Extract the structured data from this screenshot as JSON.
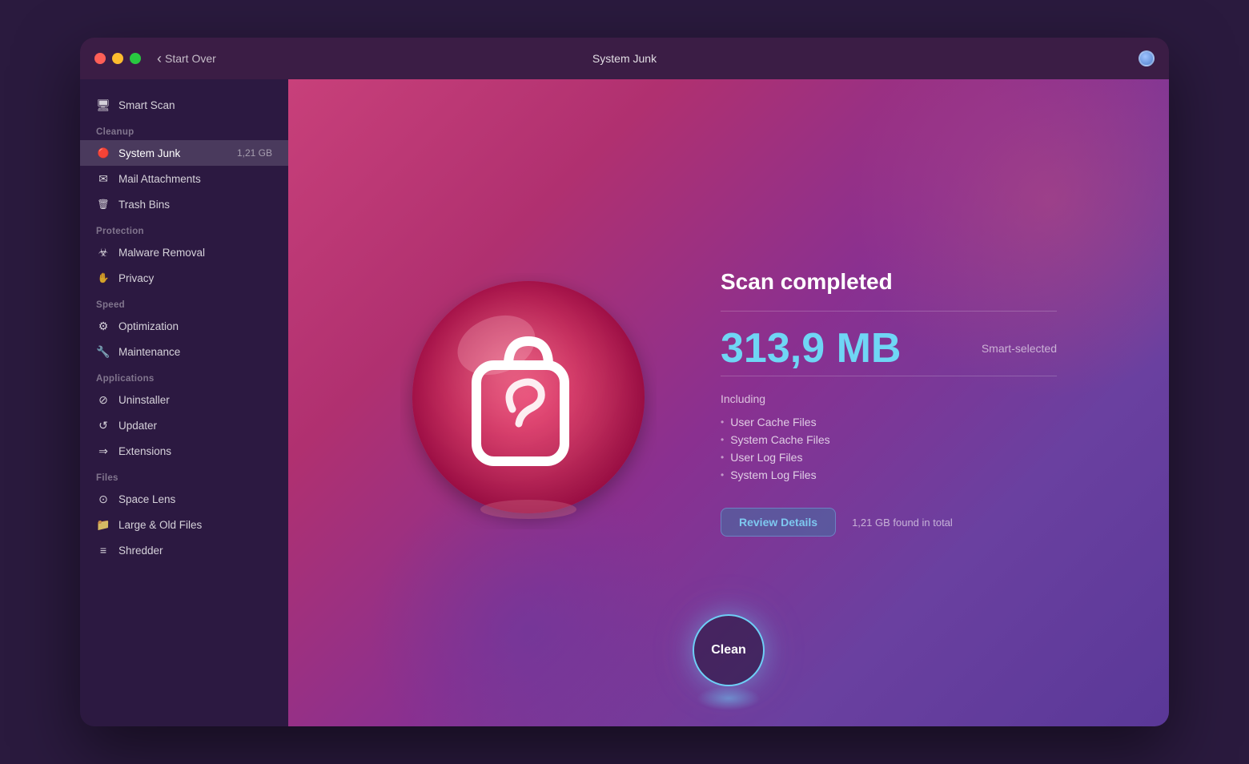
{
  "window": {
    "title": "System Junk",
    "back_label": "Start Over"
  },
  "sidebar": {
    "smart_scan": "Smart Scan",
    "sections": [
      {
        "label": "Cleanup",
        "items": [
          {
            "id": "system-junk",
            "label": "System Junk",
            "badge": "1,21 GB",
            "active": true,
            "icon": "🔴"
          },
          {
            "id": "mail-attachments",
            "label": "Mail Attachments",
            "badge": "",
            "active": false,
            "icon": "✉"
          },
          {
            "id": "trash-bins",
            "label": "Trash Bins",
            "badge": "",
            "active": false,
            "icon": "🗑"
          }
        ]
      },
      {
        "label": "Protection",
        "items": [
          {
            "id": "malware-removal",
            "label": "Malware Removal",
            "badge": "",
            "active": false,
            "icon": "☣"
          },
          {
            "id": "privacy",
            "label": "Privacy",
            "badge": "",
            "active": false,
            "icon": "✋"
          }
        ]
      },
      {
        "label": "Speed",
        "items": [
          {
            "id": "optimization",
            "label": "Optimization",
            "badge": "",
            "active": false,
            "icon": "⚙"
          },
          {
            "id": "maintenance",
            "label": "Maintenance",
            "badge": "",
            "active": false,
            "icon": "🔧"
          }
        ]
      },
      {
        "label": "Applications",
        "items": [
          {
            "id": "uninstaller",
            "label": "Uninstaller",
            "badge": "",
            "active": false,
            "icon": "⊘"
          },
          {
            "id": "updater",
            "label": "Updater",
            "badge": "",
            "active": false,
            "icon": "↺"
          },
          {
            "id": "extensions",
            "label": "Extensions",
            "badge": "",
            "active": false,
            "icon": "⇒"
          }
        ]
      },
      {
        "label": "Files",
        "items": [
          {
            "id": "space-lens",
            "label": "Space Lens",
            "badge": "",
            "active": false,
            "icon": "⊙"
          },
          {
            "id": "large-old-files",
            "label": "Large & Old Files",
            "badge": "",
            "active": false,
            "icon": "📁"
          },
          {
            "id": "shredder",
            "label": "Shredder",
            "badge": "",
            "active": false,
            "icon": "≡"
          }
        ]
      }
    ]
  },
  "main": {
    "scan_completed": "Scan completed",
    "size_value": "313,9 MB",
    "smart_selected": "Smart-selected",
    "including_label": "Including",
    "file_items": [
      "User Cache Files",
      "System Cache Files",
      "User Log Files",
      "System Log Files"
    ],
    "review_btn": "Review Details",
    "found_total": "1,21 GB found in total",
    "clean_btn": "Clean"
  }
}
